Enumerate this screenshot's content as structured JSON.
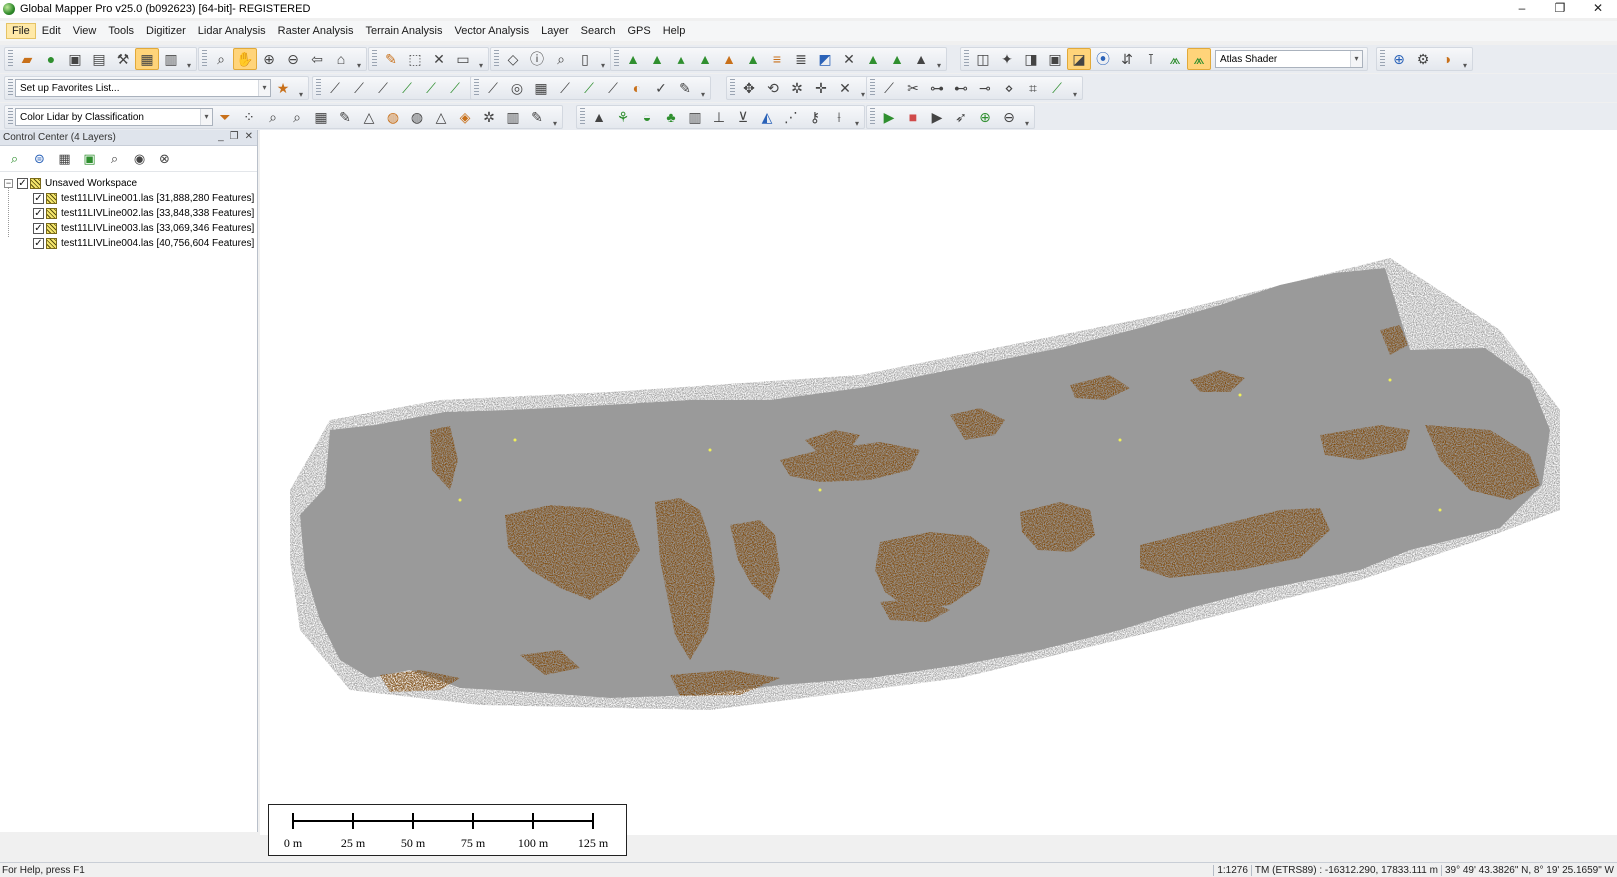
{
  "window": {
    "title": "Global Mapper Pro v25.0 (b092623) [64-bit]- REGISTERED",
    "minimize": "–",
    "restore": "❐",
    "close": "✕"
  },
  "menu": {
    "items": [
      "File",
      "Edit",
      "View",
      "Tools",
      "Digitizer",
      "Lidar Analysis",
      "Raster Analysis",
      "Terrain Analysis",
      "Vector Analysis",
      "Layer",
      "Search",
      "GPS",
      "Help"
    ],
    "active": "File"
  },
  "toolbar": {
    "shader_select": "Atlas Shader",
    "favorites_select": "Set up Favorites List...",
    "lidar_color_select": "Color Lidar by Classification"
  },
  "control_center": {
    "title": "Control Center (4 Layers)",
    "workspace": "Unsaved Workspace",
    "layers": [
      "test11LIVLine001.las [31,888,280 Features]",
      "test11LIVLine002.las [33,848,338 Features]",
      "test11LIVLine003.las [33,069,346 Features]",
      "test11LIVLine004.las [40,756,604 Features]"
    ]
  },
  "scale_bar": {
    "labels": [
      "0 m",
      "25 m",
      "50 m",
      "75 m",
      "100 m",
      "125 m"
    ]
  },
  "colors": {
    "ground_class": "#9a9a9a",
    "vegetation_class": "#7f4406",
    "highlight_class": "#f0f05a",
    "active_button": "#ffd47a"
  },
  "status": {
    "help_text": "For Help, press F1",
    "scale": "1:1276",
    "projection": "TM (ETRS89) : -16312.290, 17833.111 m",
    "geo_coords": "39° 49' 43.3826\" N, 8° 19' 25.1659\" W"
  }
}
